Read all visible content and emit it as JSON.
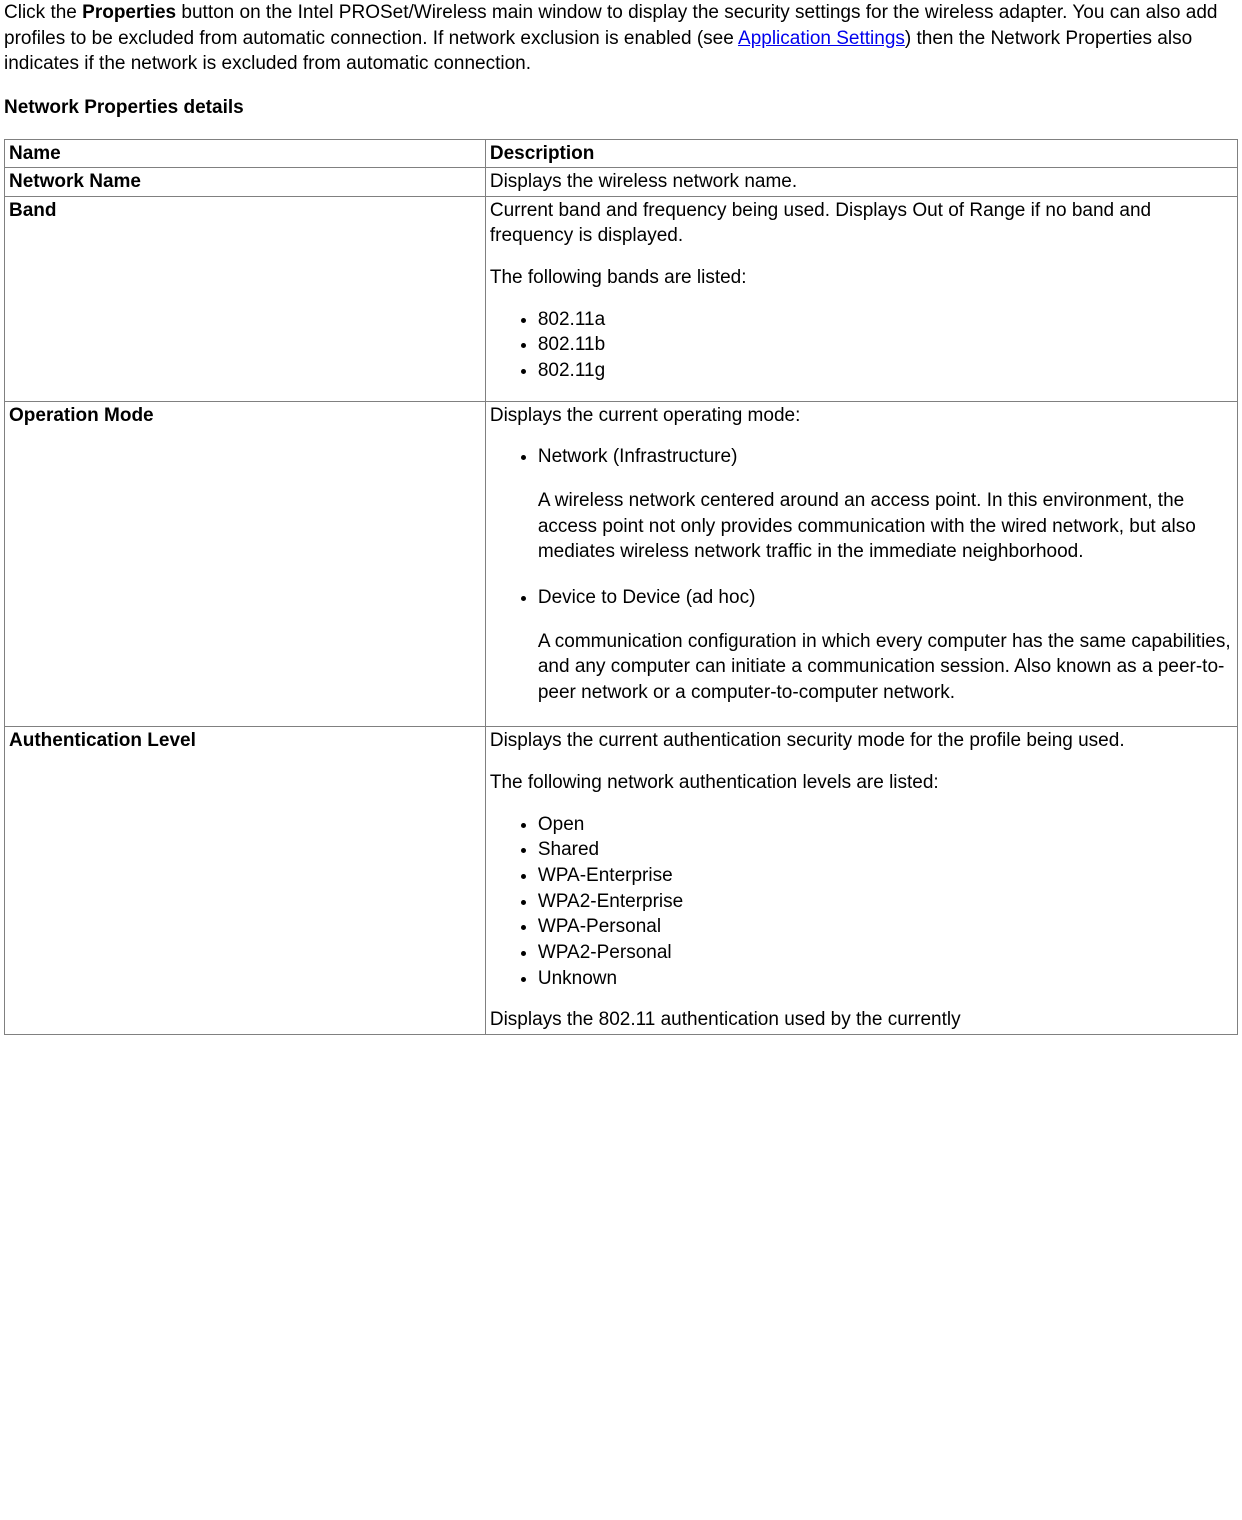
{
  "intro": {
    "t1": "Click the ",
    "b1": "Properties",
    "t2": " button on the Intel PROSet/Wireless main window to display the security settings for the wireless adapter. You can also add profiles to be excluded from automatic connection. If network exclusion is enabled (see ",
    "link": "Application Settings",
    "t3": ") then the Network Properties also indicates if the network is excluded from automatic connection."
  },
  "section_title": "Network Properties details",
  "headers": {
    "name": "Name",
    "description": "Description"
  },
  "rows": {
    "network_name": {
      "label": "Network Name",
      "desc": "Displays the wireless network name."
    },
    "band": {
      "label": "Band",
      "p1": "Current band and frequency being used. Displays Out of Range if no band and frequency is displayed.",
      "p2": "The following bands are listed:",
      "items": [
        "802.11a",
        "802.11b",
        "802.11g"
      ]
    },
    "op_mode": {
      "label": "Operation Mode",
      "p1": "Displays the current operating mode:",
      "item1_title": "Network (Infrastructure)",
      "item1_desc": "A wireless network centered around an access point. In this environment, the access point not only provides communication with the wired network, but also mediates wireless network traffic in the immediate neighborhood.",
      "item2_title": "Device to Device (ad hoc)",
      "item2_desc": "A communication configuration in which every computer has the same capabilities, and any computer can initiate a communication session. Also known as a peer-to-peer network or a computer-to-computer network."
    },
    "auth": {
      "label": "Authentication Level",
      "p1": "Displays the current authentication security mode for the profile being used.",
      "p2": "The following network authentication levels are listed:",
      "items": [
        "Open",
        "Shared",
        "WPA-Enterprise",
        "WPA2-Enterprise",
        "WPA-Personal",
        "WPA2-Personal",
        "Unknown"
      ],
      "p3": "Displays the 802.11 authentication used by the currently"
    }
  }
}
